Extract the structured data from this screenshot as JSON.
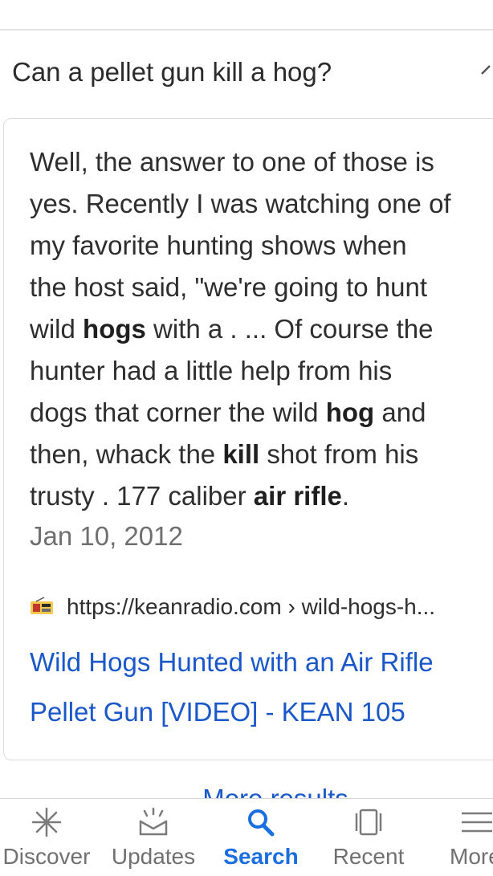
{
  "question": {
    "text": "Can a pellet gun kill a hog?"
  },
  "answer": {
    "lines": [
      [
        {
          "t": "Well, the answer to one of those is",
          "b": false
        }
      ],
      [
        {
          "t": "yes. Recently I was watching one of",
          "b": false
        }
      ],
      [
        {
          "t": "my favorite hunting shows when",
          "b": false
        }
      ],
      [
        {
          "t": "the host said, \"we're going to hunt",
          "b": false
        }
      ],
      [
        {
          "t": "wild ",
          "b": false
        },
        {
          "t": "hogs",
          "b": true
        },
        {
          "t": " with a . ... Of course the",
          "b": false
        }
      ],
      [
        {
          "t": "hunter had a little help from his",
          "b": false
        }
      ],
      [
        {
          "t": "dogs that corner the wild ",
          "b": false
        },
        {
          "t": "hog",
          "b": true
        },
        {
          "t": " and",
          "b": false
        }
      ],
      [
        {
          "t": "then, whack the ",
          "b": false
        },
        {
          "t": "kill",
          "b": true
        },
        {
          "t": " shot from his",
          "b": false
        }
      ],
      [
        {
          "t": "trusty . 177 caliber ",
          "b": false
        },
        {
          "t": "air rifle",
          "b": true
        },
        {
          "t": ".",
          "b": false
        }
      ]
    ],
    "date": "Jan 10, 2012",
    "source_url": "https://keanradio.com › wild-hogs-h...",
    "favicon_icon": "radio-station-favicon-icon",
    "link_title_line1": "Wild Hogs Hunted with an Air Rifle",
    "link_title_line2": "Pellet Gun [VIDEO] - KEAN 105"
  },
  "more_results": "More results",
  "colors": {
    "link": "#1a57c8",
    "active_tab": "#1a6fe0",
    "inactive_tab": "#707070"
  },
  "nav": {
    "items": [
      {
        "label": "Discover",
        "icon": "discover-asterisk-icon",
        "active": false
      },
      {
        "label": "Updates",
        "icon": "updates-inbox-icon",
        "active": false
      },
      {
        "label": "Search",
        "icon": "search-icon",
        "active": true
      },
      {
        "label": "Recent",
        "icon": "recent-cards-icon",
        "active": false
      },
      {
        "label": "More",
        "icon": "menu-icon",
        "active": false
      }
    ]
  }
}
